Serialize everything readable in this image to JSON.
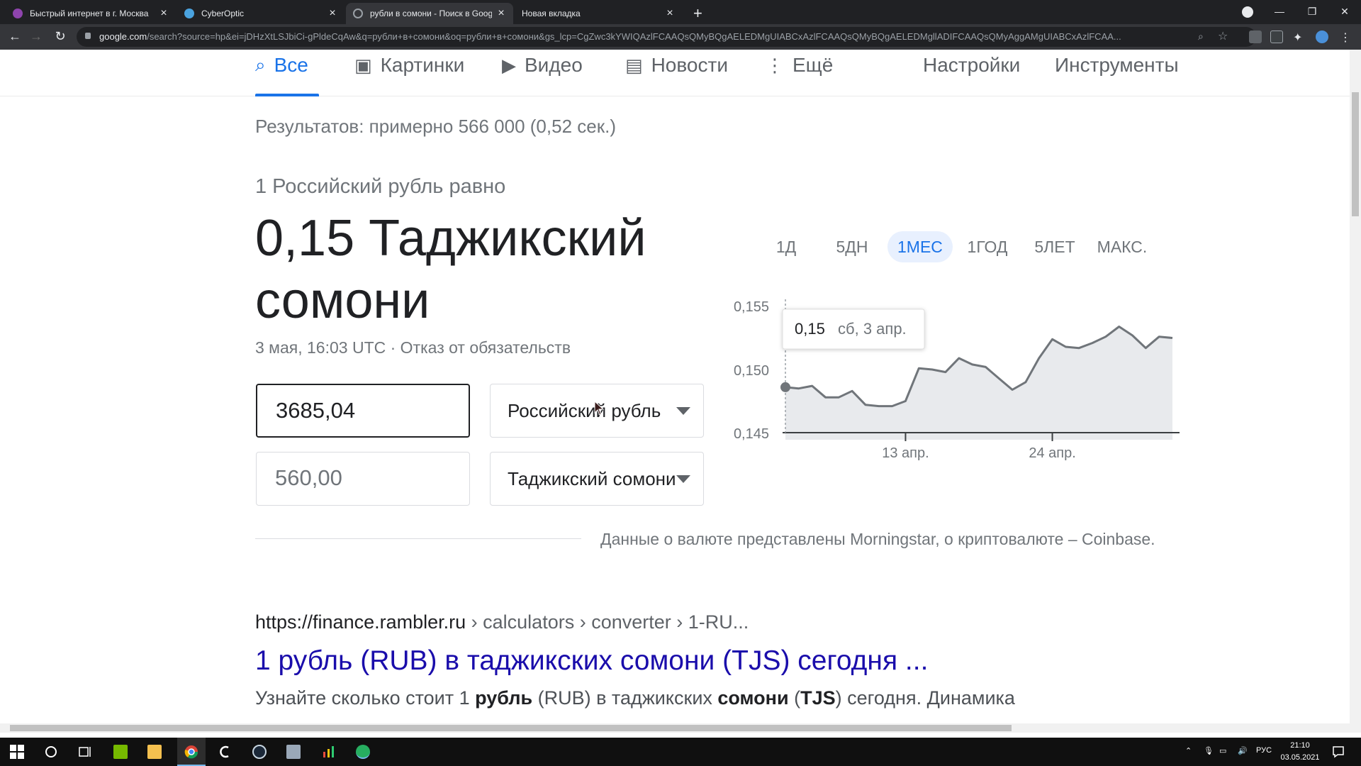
{
  "browser": {
    "tabs": [
      {
        "title": "Быстрый интернет в г. Москва",
        "favicon_color": "#8e44ad",
        "active": false
      },
      {
        "title": "CyberOptic",
        "favicon_color": "#4aa3df",
        "active": false
      },
      {
        "title": "рубли в сомони - Поиск в Goog",
        "favicon_color": "#ffffff",
        "active": true
      },
      {
        "title": "Новая вкладка",
        "favicon_color": "",
        "active": false
      }
    ],
    "url_host": "google.com",
    "url_rest": "/search?source=hp&ei=jDHzXtLSJbiCi-gPldeCqAw&q=рубли+в+сомони&oq=рубли+в+сомони&gs_lcp=CgZwc3kYWIQAzlFCAAQsQMyBQgAELEDMgUIABCxAzlFCAAQsQMyBQgAELEDMgllADIFCAAQsQMyAggAMgUIABCxAzlFCAA..."
  },
  "gnav": {
    "tabs": [
      {
        "label": "Все",
        "icon": "search-icon",
        "active": true
      },
      {
        "label": "Картинки",
        "icon": "image-icon",
        "active": false
      },
      {
        "label": "Видео",
        "icon": "video-icon",
        "active": false
      },
      {
        "label": "Новости",
        "icon": "news-icon",
        "active": false
      },
      {
        "label": "Ещё",
        "icon": "more-vert-icon",
        "active": false
      }
    ],
    "settings": "Настройки",
    "tools": "Инструменты"
  },
  "stats": "Результатов: примерно 566 000 (0,52 сек.)",
  "converter": {
    "equals_label": "1 Российский рубль равно",
    "result": "0,15 Таджикский сомони",
    "date": "3 мая, 16:03 UTC · Отказ от обязательств",
    "amount_from": "3685,04",
    "amount_to": "560,00",
    "currency_from": "Российский рубль",
    "currency_to": "Таджикский сомони",
    "ranges": [
      "1Д",
      "5ДН",
      "1МЕС",
      "1ГОД",
      "5ЛЕТ",
      "МАКС."
    ],
    "active_range": "1МЕС",
    "tooltip_value": "0,15",
    "tooltip_date": "сб, 3 апр.",
    "source_note": "Данные о валюте представлены Morningstar, о криптовалюте – Coinbase."
  },
  "chart_data": {
    "type": "area",
    "y_ticks": [
      "0,155",
      "0,150",
      "0,145"
    ],
    "ylim": [
      0.145,
      0.155
    ],
    "x_ticks": [
      "13 апр.",
      "24 апр."
    ],
    "x_tick_index": [
      9,
      20
    ],
    "values": [
      0.1486,
      0.1485,
      0.1487,
      0.1478,
      0.1478,
      0.1483,
      0.1472,
      0.1471,
      0.1471,
      0.1475,
      0.1501,
      0.15,
      0.1498,
      0.1509,
      0.1504,
      0.1502,
      0.1493,
      0.1484,
      0.149,
      0.1509,
      0.1524,
      0.1518,
      0.1517,
      0.1521,
      0.1526,
      0.1534,
      0.1527,
      0.1517,
      0.1526,
      0.1525
    ],
    "line_color": "#70757a",
    "fill_color": "#e8eaed"
  },
  "result": {
    "url_main": "https://finance.rambler.ru",
    "url_path": " › calculators › converter › 1-RU...",
    "title": "1 рубль (RUB) в таджикских сомони (TJS) сегодня ...",
    "snippet_parts": [
      {
        "t": "Узнайте сколько стоит 1 ",
        "b": false
      },
      {
        "t": "рубль",
        "b": true
      },
      {
        "t": " (RUB) в таджикских ",
        "b": false
      },
      {
        "t": "сомони",
        "b": true
      },
      {
        "t": " (",
        "b": false
      },
      {
        "t": "TJS",
        "b": true
      },
      {
        "t": ") сегодня. Динамика",
        "b": false
      }
    ]
  },
  "taskbar": {
    "lang": "РУС",
    "time": "21:10",
    "date": "03.05.2021"
  }
}
